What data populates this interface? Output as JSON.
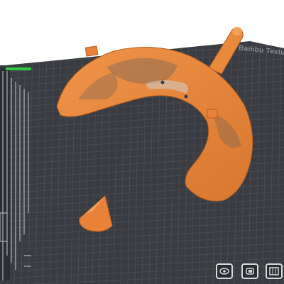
{
  "plate": {
    "brand_text": "Bambu Textur",
    "plate_color": "#3a3c41",
    "grid_color": "#4a4d53",
    "edge_color": "#2b2d31"
  },
  "model": {
    "color": "#e8823a",
    "dark_color": "#b85e20",
    "objects": [
      "curved-bracket",
      "cone"
    ]
  },
  "toolbar": {
    "buttons": [
      {
        "name": "orient-view-button",
        "icon": "eye-icon"
      },
      {
        "name": "support-paint-button",
        "icon": "paint-icon"
      },
      {
        "name": "arrange-button",
        "icon": "grid-icon"
      }
    ]
  }
}
